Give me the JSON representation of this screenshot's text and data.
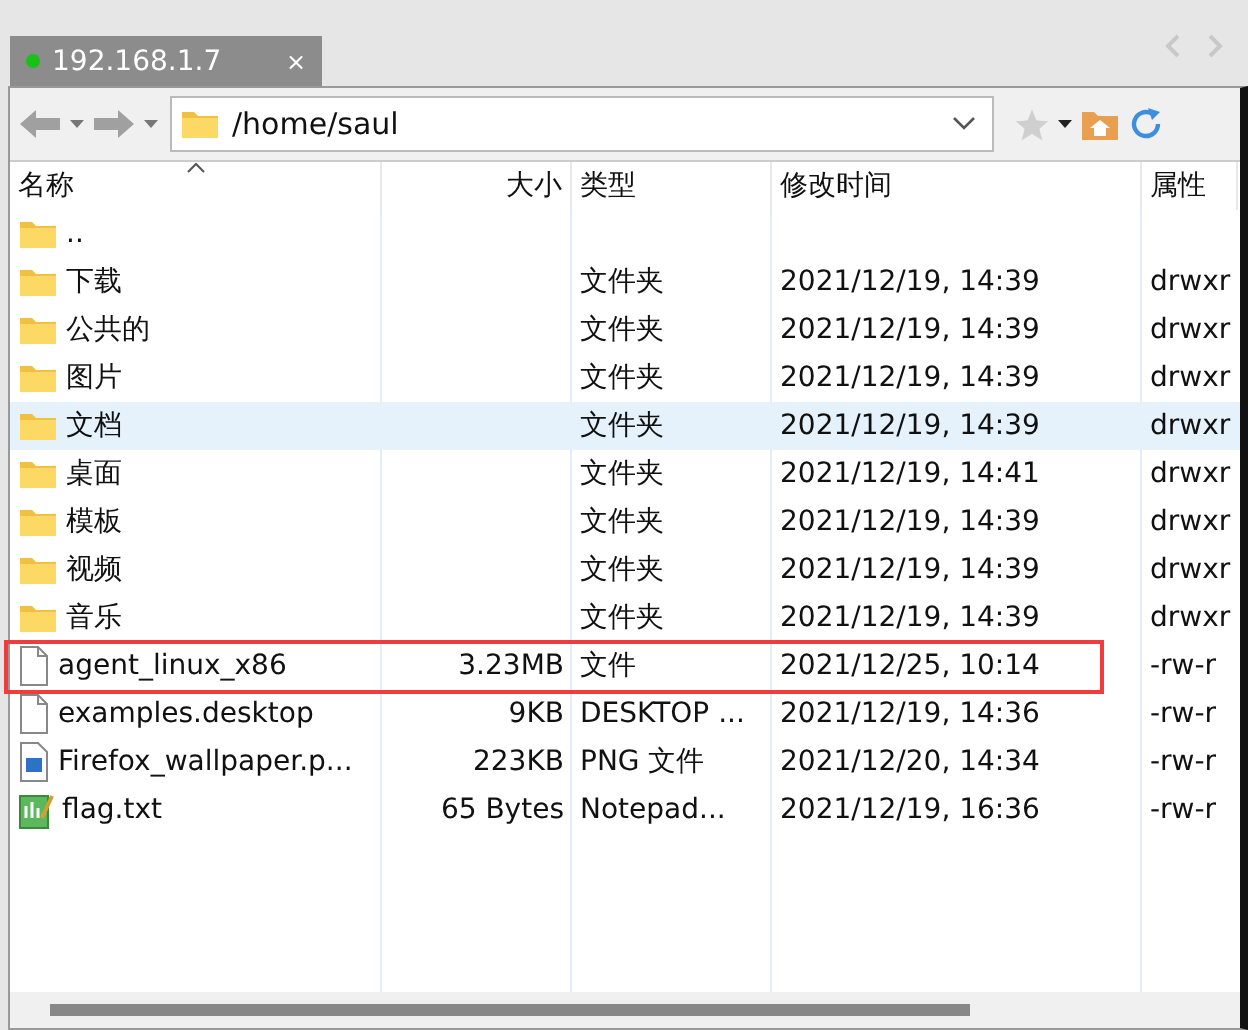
{
  "tab": {
    "title": "192.168.1.7",
    "connected": true,
    "close": "×"
  },
  "address": {
    "value": "/home/saul"
  },
  "columns": [
    {
      "label": "名称",
      "sorted": true
    },
    {
      "label": "大小",
      "sorted": false
    },
    {
      "label": "类型",
      "sorted": false
    },
    {
      "label": "修改时间",
      "sorted": false
    },
    {
      "label": "属性",
      "sorted": false
    }
  ],
  "rows": [
    {
      "kind": "folder",
      "name": "..",
      "selected": false,
      "highlighted": false
    },
    {
      "kind": "folder",
      "name": "下载",
      "type": "文件夹",
      "modified": "2021/12/19, 14:39",
      "attributes": "drwxr",
      "selected": false,
      "highlighted": false
    },
    {
      "kind": "folder",
      "name": "公共的",
      "type": "文件夹",
      "modified": "2021/12/19, 14:39",
      "attributes": "drwxr",
      "selected": false,
      "highlighted": false
    },
    {
      "kind": "folder",
      "name": "图片",
      "type": "文件夹",
      "modified": "2021/12/19, 14:39",
      "attributes": "drwxr",
      "selected": false,
      "highlighted": false
    },
    {
      "kind": "folder",
      "name": "文档",
      "type": "文件夹",
      "modified": "2021/12/19, 14:39",
      "attributes": "drwxr",
      "selected": true,
      "highlighted": false
    },
    {
      "kind": "folder",
      "name": "桌面",
      "type": "文件夹",
      "modified": "2021/12/19, 14:41",
      "attributes": "drwxr",
      "selected": false,
      "highlighted": false
    },
    {
      "kind": "folder",
      "name": "模板",
      "type": "文件夹",
      "modified": "2021/12/19, 14:39",
      "attributes": "drwxr",
      "selected": false,
      "highlighted": false
    },
    {
      "kind": "folder",
      "name": "视频",
      "type": "文件夹",
      "modified": "2021/12/19, 14:39",
      "attributes": "drwxr",
      "selected": false,
      "highlighted": false
    },
    {
      "kind": "folder",
      "name": "音乐",
      "type": "文件夹",
      "modified": "2021/12/19, 14:39",
      "attributes": "drwxr",
      "selected": false,
      "highlighted": false
    },
    {
      "kind": "file",
      "name": "agent_linux_x86",
      "size": "3.23MB",
      "type": "文件",
      "modified": "2021/12/25, 10:14",
      "attributes": "-rw-r",
      "selected": false,
      "highlighted": true
    },
    {
      "kind": "file",
      "name": "examples.desktop",
      "size": "9KB",
      "type": "DESKTOP ...",
      "modified": "2021/12/19, 14:36",
      "attributes": "-rw-r",
      "selected": false,
      "highlighted": false
    },
    {
      "kind": "image",
      "name": "Firefox_wallpaper.p...",
      "size": "223KB",
      "type": "PNG 文件",
      "modified": "2021/12/20, 14:34",
      "attributes": "-rw-r",
      "selected": false,
      "highlighted": false
    },
    {
      "kind": "notepad",
      "name": "flag.txt",
      "size": "65 Bytes",
      "type": "Notepad...",
      "modified": "2021/12/19, 16:36",
      "attributes": "-rw-r",
      "selected": false,
      "highlighted": false
    }
  ]
}
